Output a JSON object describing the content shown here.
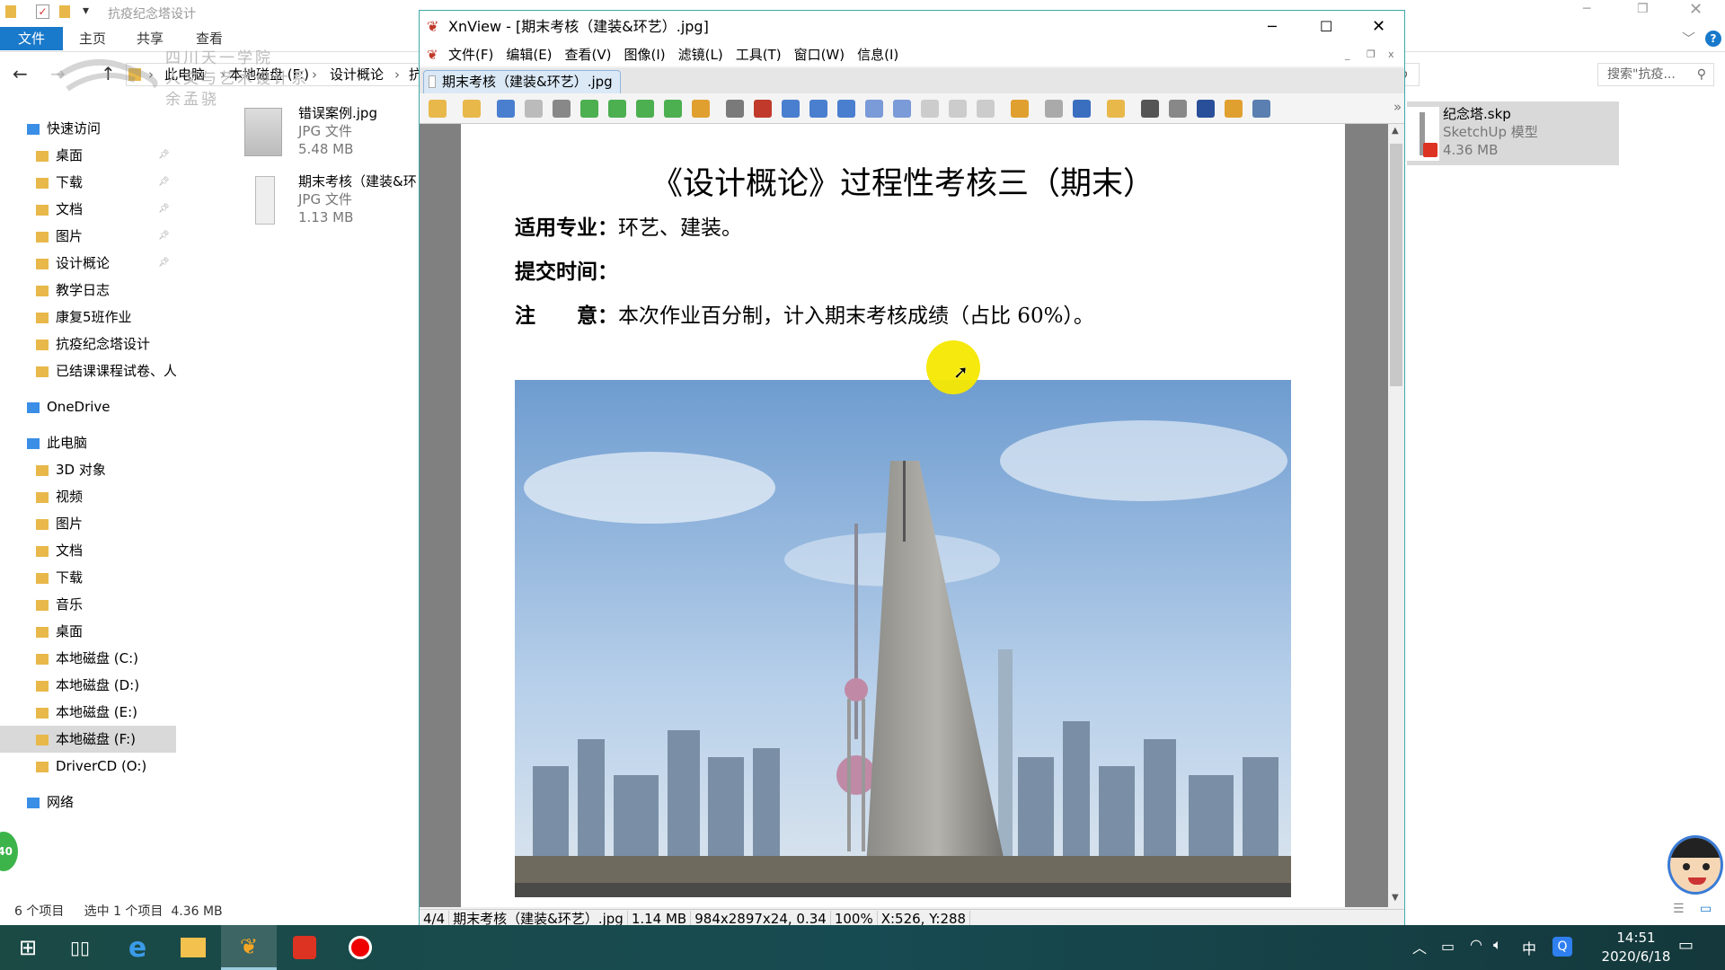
{
  "explorer": {
    "title": "抗疫纪念塔设计",
    "ribbon_tabs": [
      "文件",
      "主页",
      "共享",
      "查看"
    ],
    "breadcrumb": [
      "此电脑",
      "本地磁盘 (F:)",
      "设计概论",
      "抗"
    ],
    "search_placeholder": "搜索\"抗疫...",
    "watermark": [
      "四川天一学院",
      "人文与艺术设计系",
      "余孟骁"
    ],
    "sidebar": [
      {
        "label": "快速访问",
        "pinned": false,
        "head": true
      },
      {
        "label": "桌面",
        "pinned": true
      },
      {
        "label": "下载",
        "pinned": true
      },
      {
        "label": "文档",
        "pinned": true
      },
      {
        "label": "图片",
        "pinned": true
      },
      {
        "label": "设计概论",
        "pinned": true
      },
      {
        "label": "教学日志"
      },
      {
        "label": "康复5班作业"
      },
      {
        "label": "抗疫纪念塔设计"
      },
      {
        "label": "已结课课程试卷、人"
      },
      {
        "label": "OneDrive",
        "head": true
      },
      {
        "label": "此电脑",
        "head": true
      },
      {
        "label": "3D 对象"
      },
      {
        "label": "视频"
      },
      {
        "label": "图片"
      },
      {
        "label": "文档"
      },
      {
        "label": "下载"
      },
      {
        "label": "音乐"
      },
      {
        "label": "桌面"
      },
      {
        "label": "本地磁盘 (C:)"
      },
      {
        "label": "本地磁盘 (D:)"
      },
      {
        "label": "本地磁盘 (E:)"
      },
      {
        "label": "本地磁盘 (F:)",
        "selected": true
      },
      {
        "label": "DriverCD (O:)"
      },
      {
        "label": "网络",
        "head": true
      }
    ],
    "files": [
      {
        "name": "错误案例.jpg",
        "type": "JPG 文件",
        "size": "5.48 MB"
      },
      {
        "name": "期末考核（建装&环",
        "type": "JPG 文件",
        "size": "1.13 MB"
      },
      {
        "name": "纪念塔.skp",
        "type": "SketchUp 模型",
        "size": "4.36 MB",
        "selected": true
      }
    ],
    "status": {
      "count": "6 个项目",
      "selected": "选中 1 个项目",
      "size": "4.36 MB"
    }
  },
  "xnview": {
    "title": "XnView - [期末考核（建装&环艺）.jpg]",
    "menu": [
      "文件(F)",
      "编辑(E)",
      "查看(V)",
      "图像(I)",
      "滤镜(L)",
      "工具(T)",
      "窗口(W)",
      "信息(I)"
    ],
    "tab": "期末考核（建装&环艺）.jpg",
    "document": {
      "heading": "《设计概论》过程性考核三（期末）",
      "line1_label": "适用专业：",
      "line1_value": "环艺、建装。",
      "line2_label": "提交时间：",
      "line3_label": "注　　意：",
      "line3_value": "本次作业百分制，计入期末考核成绩（占比 60%）。"
    },
    "status": [
      "4/4",
      "期末考核（建装&环艺）.jpg",
      "1.14 MB",
      "984x2897x24, 0.34",
      "100%",
      "X:526, Y:288"
    ]
  },
  "taskbar": {
    "time": "14:51",
    "date": "2020/6/18",
    "ime": "中",
    "badge": "40"
  },
  "colors": {
    "accent": "#1979ca",
    "taskbar": "#1b4a45",
    "cursor_highlight": "#f5e800"
  }
}
